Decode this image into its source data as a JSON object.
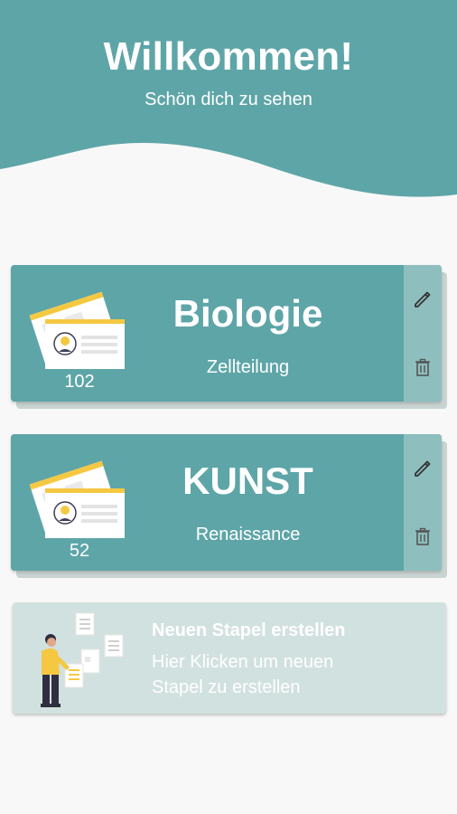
{
  "header": {
    "title": "Willkommen!",
    "subtitle": "Schön dich zu sehen"
  },
  "decks": [
    {
      "title": "Biologie",
      "topic": "Zellteilung",
      "count": "102"
    },
    {
      "title": "KUNST",
      "topic": "Renaissance",
      "count": "52"
    }
  ],
  "new_deck": {
    "title": "Neuen Stapel erstellen",
    "description": "Hier Klicken um neuen Stapel zu erstellen"
  },
  "icons": {
    "edit": "pencil-icon",
    "delete": "trash-icon",
    "deck_illustration": "flashcards-illustration",
    "new_deck_illustration": "person-with-cards-illustration"
  },
  "colors": {
    "primary": "#5ea5a8",
    "actions_panel": "#8ebfbe",
    "new_deck_background": "#d1e1df",
    "background": "#f8f8f8",
    "accent_yellow": "#f5c842"
  }
}
